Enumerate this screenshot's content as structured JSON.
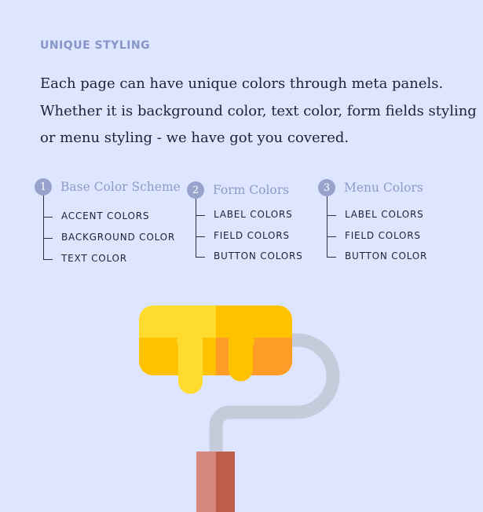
{
  "eyebrow": "UNIQUE STYLING",
  "lead": {
    "line1": "Each page can have unique colors through meta panels.",
    "line2": "Whether it is background color, text color, form fields styling",
    "line3": "or menu styling - we have got you covered."
  },
  "groups": [
    {
      "number": "1",
      "title": "Base Color Scheme",
      "items": [
        "ACCENT COLORS",
        "BACKGROUND COLOR",
        "TEXT COLOR"
      ]
    },
    {
      "number": "2",
      "title": "Form Colors",
      "items": [
        "LABEL COLORS",
        "FIELD COLORS",
        "BUTTON COLORS"
      ]
    },
    {
      "number": "3",
      "title": "Menu Colors",
      "items": [
        "LABEL COLORS",
        "FIELD COLORS",
        "BUTTON COLOR"
      ]
    }
  ],
  "illustration": {
    "icon": "paint-roller-icon",
    "colors": {
      "roller_light": "#ffdb2d",
      "roller_yellow": "#ffc200",
      "roller_orange": "#ff9b27",
      "frame": "#c5cbdb",
      "handle_light": "#d4877a",
      "handle_dark": "#bf5d4c"
    }
  }
}
